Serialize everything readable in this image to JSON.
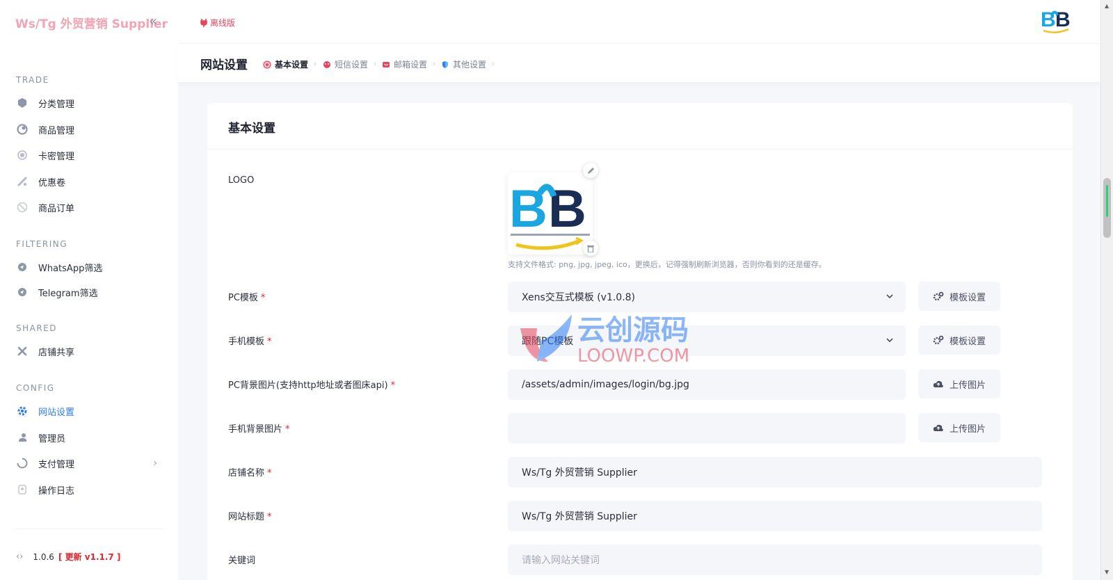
{
  "brand": {
    "title": "Ws/Tg 外贸营销 Supplier",
    "collapse_icon": "«"
  },
  "topbar": {
    "offline_label": "离线版",
    "logo_text": "B2B"
  },
  "sidebar": {
    "sections": [
      {
        "title": "TRADE",
        "items": [
          {
            "label": "分类管理",
            "icon": "folder-icon"
          },
          {
            "label": "商品管理",
            "icon": "product-icon"
          },
          {
            "label": "卡密管理",
            "icon": "card-icon"
          },
          {
            "label": "优惠卷",
            "icon": "coupon-icon"
          },
          {
            "label": "商品订单",
            "icon": "order-icon"
          }
        ]
      },
      {
        "title": "FILTERING",
        "items": [
          {
            "label": "WhatsApp筛选",
            "icon": "filter-icon"
          },
          {
            "label": "Telegram筛选",
            "icon": "filter-icon"
          }
        ]
      },
      {
        "title": "SHARED",
        "items": [
          {
            "label": "店铺共享",
            "icon": "share-icon"
          }
        ]
      },
      {
        "title": "CONFIG",
        "items": [
          {
            "label": "网站设置",
            "icon": "gear-icon",
            "active": true
          },
          {
            "label": "管理员",
            "icon": "admin-icon"
          },
          {
            "label": "支付管理",
            "icon": "payment-icon",
            "has_arrow": true
          },
          {
            "label": "操作日志",
            "icon": "log-icon"
          }
        ]
      }
    ],
    "version": "1.0.6",
    "update_label": "[ 更新 v1.1.7 ]"
  },
  "page": {
    "title": "网站设置",
    "tabs": [
      {
        "label": "基本设置",
        "active": true
      },
      {
        "label": "短信设置"
      },
      {
        "label": "邮箱设置"
      },
      {
        "label": "其他设置"
      }
    ]
  },
  "form": {
    "card_title": "基本设置",
    "logo": {
      "label": "LOGO",
      "hint": "支持文件格式: png, jpg, jpeg, ico，更换后，记得强制刷新浏览器，否则你看到的还是缓存。"
    },
    "pc_template": {
      "label": "PC模板",
      "value": "Xens交互式模板 (v1.0.8)",
      "button": "模板设置"
    },
    "mobile_template": {
      "label": "手机模板",
      "value": "跟随PC模板",
      "button": "模板设置"
    },
    "pc_bg": {
      "label": "PC背景图片(支持http地址或者图床api)",
      "value": "/assets/admin/images/login/bg.jpg",
      "button": "上传图片"
    },
    "mobile_bg": {
      "label": "手机背景图片",
      "value": "",
      "button": "上传图片"
    },
    "shop_name": {
      "label": "店铺名称",
      "value": "Ws/Tg 外贸营销 Supplier"
    },
    "site_title": {
      "label": "网站标题",
      "value": "Ws/Tg 外贸营销 Supplier"
    },
    "keywords": {
      "label": "关键词",
      "placeholder": "请输入网站关键词"
    }
  },
  "watermark": {
    "cn": "云创源码",
    "en": "LOOWP.COM"
  },
  "colors": {
    "accent": "#2f7ef6",
    "brand": "#f3a3b3",
    "required": "#e5242b",
    "offline": "#e6455c"
  }
}
